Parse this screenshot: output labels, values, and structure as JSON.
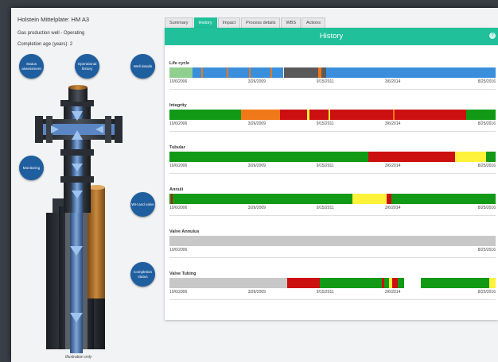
{
  "well": {
    "title": "Holstein Mittelplate: HM A3",
    "status": "Gas production well - Operating",
    "age": "Completion age (years): 2"
  },
  "bubbles": {
    "status_assessment": "Status assessment",
    "operational_history": "Operational history",
    "well_details": "Well details",
    "monitoring": "Monitoring",
    "wh_valve": "WH and valve",
    "completion_status": "Completion status"
  },
  "illustration_caption": "Illustration only",
  "tabs": [
    "Summary",
    "History",
    "Impact",
    "Process details",
    "WBS",
    "Actions"
  ],
  "active_tab": "History",
  "panel_title": "History",
  "axis_ticks": [
    "10/6/2006",
    "3/26/2009",
    "9/15/2011",
    "3/6/2014",
    "8/25/2016"
  ],
  "colors": {
    "accent": "#1fc09a",
    "bubble": "#1f5fa0",
    "green": "#129a16",
    "red": "#cc0f0f",
    "yellow": "#fff23a",
    "orange": "#f07818",
    "blue": "#3a8fdc",
    "gray": "#c8c8c8",
    "dark_gray": "#5a5a5a",
    "light_green": "#8fcf8f"
  },
  "rows": [
    {
      "label": "Life cycle",
      "ticks_shown": "all",
      "segments": [
        {
          "from": 0.0,
          "to": 0.07,
          "color": "light_green"
        },
        {
          "from": 0.07,
          "to": 0.35,
          "color": "blue"
        },
        {
          "from": 0.35,
          "to": 0.48,
          "color": "dark_gray"
        },
        {
          "from": 0.48,
          "to": 1.0,
          "color": "blue"
        },
        {
          "from": 0.098,
          "to": 0.103,
          "color": "orange"
        },
        {
          "from": 0.175,
          "to": 0.18,
          "color": "orange"
        },
        {
          "from": 0.245,
          "to": 0.25,
          "color": "orange"
        },
        {
          "from": 0.31,
          "to": 0.315,
          "color": "orange"
        },
        {
          "from": 0.455,
          "to": 0.46,
          "color": "orange"
        },
        {
          "from": 0.462,
          "to": 0.467,
          "color": "orange"
        }
      ]
    },
    {
      "label": "Integrity",
      "ticks_shown": "all",
      "segments": [
        {
          "from": 0.0,
          "to": 0.22,
          "color": "green"
        },
        {
          "from": 0.22,
          "to": 0.34,
          "color": "orange"
        },
        {
          "from": 0.34,
          "to": 0.91,
          "color": "red"
        },
        {
          "from": 0.91,
          "to": 1.0,
          "color": "green"
        },
        {
          "from": 0.423,
          "to": 0.43,
          "color": "yellow"
        },
        {
          "from": 0.487,
          "to": 0.493,
          "color": "yellow"
        },
        {
          "from": 0.685,
          "to": 0.69,
          "color": "orange"
        }
      ]
    },
    {
      "label": "Tubular",
      "ticks_shown": "all",
      "segments": [
        {
          "from": 0.0,
          "to": 0.61,
          "color": "green"
        },
        {
          "from": 0.61,
          "to": 0.875,
          "color": "red"
        },
        {
          "from": 0.875,
          "to": 0.97,
          "color": "yellow"
        },
        {
          "from": 0.97,
          "to": 1.0,
          "color": "green"
        }
      ]
    },
    {
      "label": "Annuli",
      "ticks_shown": "all",
      "segments": [
        {
          "from": 0.0,
          "to": 0.56,
          "color": "green"
        },
        {
          "from": 0.56,
          "to": 0.665,
          "color": "yellow"
        },
        {
          "from": 0.665,
          "to": 1.0,
          "color": "green"
        },
        {
          "from": 0.005,
          "to": 0.01,
          "color": "red"
        },
        {
          "from": 0.666,
          "to": 0.68,
          "color": "red"
        }
      ]
    },
    {
      "label": "Valve Annulus",
      "ticks_shown": "ends",
      "segments": [
        {
          "from": 0.0,
          "to": 1.0,
          "color": "gray"
        }
      ]
    },
    {
      "label": "Valve Tubing",
      "ticks_shown": "all",
      "segments": [
        {
          "from": 0.0,
          "to": 0.36,
          "color": "gray"
        },
        {
          "from": 0.36,
          "to": 0.46,
          "color": "red"
        },
        {
          "from": 0.46,
          "to": 0.72,
          "color": "green"
        },
        {
          "from": 0.72,
          "to": 0.77,
          "color": "white"
        },
        {
          "from": 0.77,
          "to": 0.98,
          "color": "green"
        },
        {
          "from": 0.98,
          "to": 1.0,
          "color": "yellow"
        },
        {
          "from": 0.65,
          "to": 0.658,
          "color": "red"
        },
        {
          "from": 0.672,
          "to": 0.682,
          "color": "yellow"
        },
        {
          "from": 0.684,
          "to": 0.7,
          "color": "red"
        }
      ]
    }
  ]
}
